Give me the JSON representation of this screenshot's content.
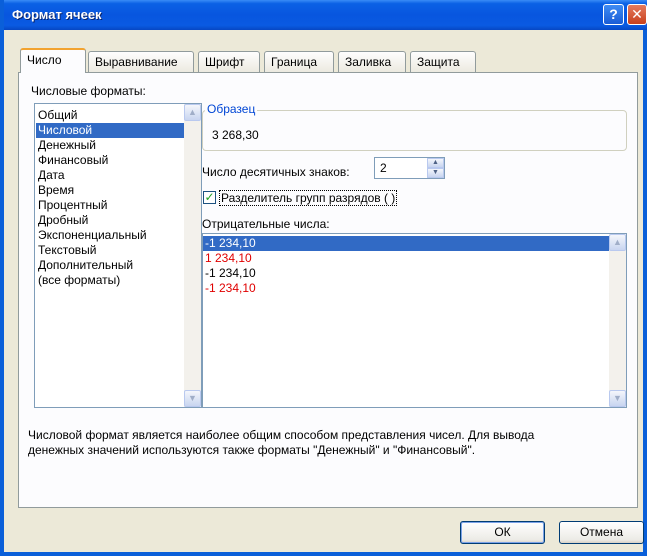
{
  "window": {
    "title": "Формат ячеек"
  },
  "titlebar_buttons": {
    "help": "?",
    "close": "✕"
  },
  "tabs": [
    {
      "label": "Число"
    },
    {
      "label": "Выравнивание"
    },
    {
      "label": "Шрифт"
    },
    {
      "label": "Граница"
    },
    {
      "label": "Заливка"
    },
    {
      "label": "Защита"
    }
  ],
  "number_formats": {
    "label": "Числовые форматы:",
    "items": [
      "Общий",
      "Числовой",
      "Денежный",
      "Финансовый",
      "Дата",
      "Время",
      "Процентный",
      "Дробный",
      "Экспоненциальный",
      "Текстовый",
      "Дополнительный",
      "(все форматы)"
    ],
    "selected": "Числовой"
  },
  "sample": {
    "label": "Образец",
    "value": "3 268,30"
  },
  "decimals": {
    "label": "Число десятичных знаков:",
    "value": "2"
  },
  "separator": {
    "label": "Разделитель групп разрядов ( )",
    "checked": true
  },
  "negatives": {
    "label": "Отрицательные числа:",
    "items": [
      {
        "text": "-1 234,10",
        "red": false,
        "selected": true
      },
      {
        "text": "1 234,10",
        "red": true,
        "selected": false
      },
      {
        "text": "-1 234,10",
        "red": false,
        "selected": false
      },
      {
        "text": "-1 234,10",
        "red": true,
        "selected": false
      }
    ]
  },
  "description": {
    "line1": "Числовой формат является наиболее общим способом представления чисел. Для вывода",
    "line2": "денежных значений используются также форматы \"Денежный\" и \"Финансовый\"."
  },
  "buttons": {
    "ok": "ОК",
    "cancel": "Отмена"
  },
  "colors": {
    "titlebar": "#0856DF",
    "selection": "#316AC5",
    "negative_red": "#E00000",
    "group_label": "#0046D5"
  }
}
